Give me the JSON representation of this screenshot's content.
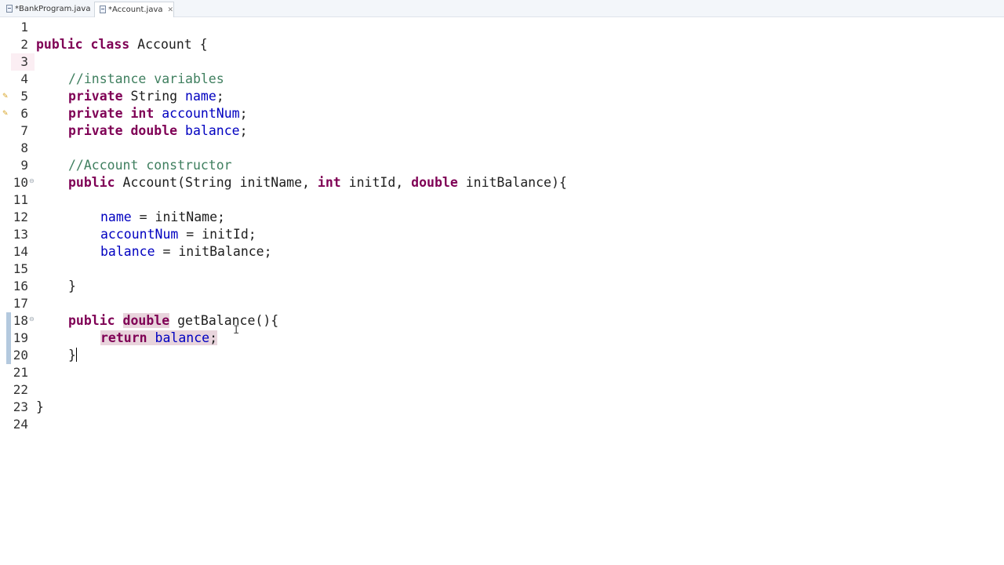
{
  "tabs": [
    {
      "label": "*BankProgram.java",
      "active": false
    },
    {
      "label": "*Account.java",
      "active": true
    }
  ],
  "icons": {
    "file": "java-file-icon",
    "close": "close-icon"
  },
  "colors": {
    "keyword": "#7f0055",
    "comment": "#3f7f5f",
    "field": "#0000c0",
    "highlight": "#e8d4dc"
  },
  "editor": {
    "line_numbers": [
      "1",
      "2",
      "3",
      "4",
      "5",
      "6",
      "7",
      "8",
      "9",
      "10",
      "11",
      "12",
      "13",
      "14",
      "15",
      "16",
      "17",
      "18",
      "19",
      "20",
      "21",
      "22",
      "23",
      "24"
    ],
    "code": {
      "l2": {
        "kw1": "public",
        "kw2": "class",
        "rest": " Account {"
      },
      "l4": {
        "comment": "//instance variables"
      },
      "l5": {
        "kw": "private",
        "type": " String ",
        "field": "name",
        "end": ";"
      },
      "l6": {
        "kw": "private",
        "type": "int",
        "field": "accountNum",
        "end": ";"
      },
      "l7": {
        "kw": "private",
        "type": "double",
        "field": "balance",
        "end": ";"
      },
      "l9": {
        "comment": "//Account constructor"
      },
      "l10": {
        "kw": "public",
        "sig": " Account(String ",
        "p1": "initName",
        "sep1": ", ",
        "t2": "int",
        "p2": " initId",
        "sep2": ", ",
        "t3": "double",
        "p3": " initBalance",
        "end": "){"
      },
      "l12": {
        "field": "name",
        "rest": " = initName;"
      },
      "l13": {
        "field": "accountNum",
        "rest": " = initId;"
      },
      "l14": {
        "field": "balance",
        "rest": " = initBalance;"
      },
      "l16": {
        "brace": "}"
      },
      "l18": {
        "kw": "public",
        "type": "double",
        "rest": " getBalance(){"
      },
      "l19": {
        "kw": "return",
        "field": "balance",
        "end": ";"
      },
      "l20": {
        "brace": "}"
      },
      "l23": {
        "brace": "}"
      }
    }
  }
}
